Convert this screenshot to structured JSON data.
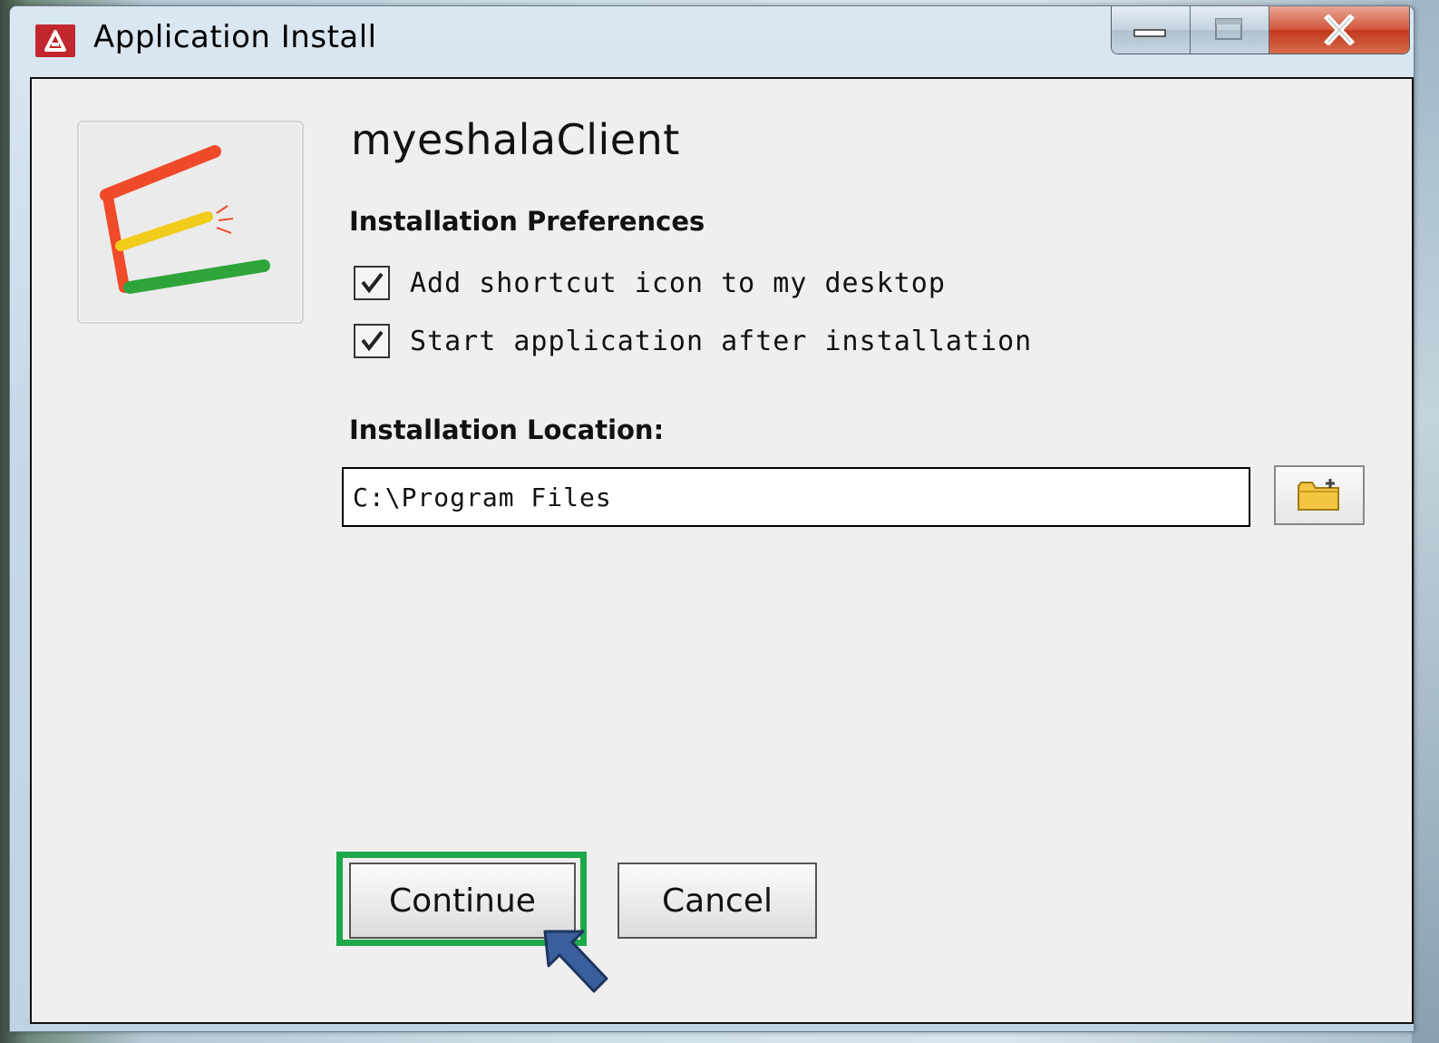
{
  "window": {
    "title": "Application Install"
  },
  "app": {
    "name": "myeshalaClient"
  },
  "preferences": {
    "heading": "Installation Preferences",
    "options": [
      {
        "label": "Add shortcut icon to my desktop",
        "checked": true
      },
      {
        "label": "Start application after installation",
        "checked": true
      }
    ]
  },
  "location": {
    "heading": "Installation Location:",
    "value": "C:\\Program Files"
  },
  "buttons": {
    "continue": "Continue",
    "cancel": "Cancel"
  },
  "icons": {
    "title": "air-installer-icon",
    "minimize": "minimize-icon",
    "maximize": "maximize-icon",
    "close": "close-icon",
    "browse": "folder-icon",
    "pointer": "arrow-pointer-icon"
  },
  "colors": {
    "highlight": "#1da84a",
    "close_button": "#c2381c",
    "arrow": "#3a5f9c"
  }
}
